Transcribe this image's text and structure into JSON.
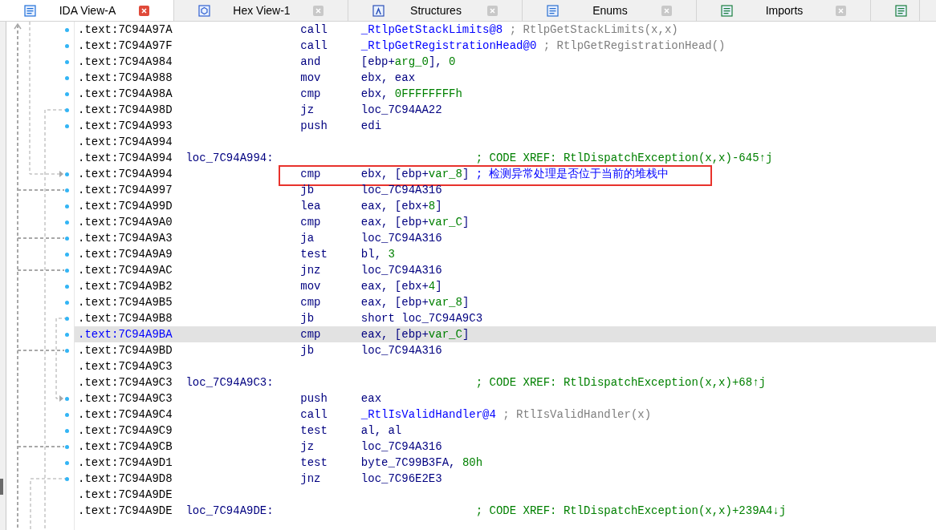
{
  "tabs": [
    {
      "label": "IDA View-A",
      "selected": true
    },
    {
      "label": "Hex View-1",
      "selected": false
    },
    {
      "label": "Structures",
      "selected": false
    },
    {
      "label": "Enums",
      "selected": false
    },
    {
      "label": "Imports",
      "selected": false
    },
    {
      "selected": false
    }
  ],
  "rows": [
    {
      "kind": "instruction",
      "address": ".text:7C94A97A",
      "mnemonic": "call",
      "operand": [
        {
          "t": "_RtlpGetStackLimits@8",
          "kind": "sym"
        }
      ],
      "comment": {
        "t": "; RtlpGetStackLimits(x,x)",
        "kind": "auto"
      },
      "selected": false
    },
    {
      "kind": "instruction",
      "address": ".text:7C94A97F",
      "mnemonic": "call",
      "operand": [
        {
          "t": "_RtlpGetRegistrationHead@0",
          "kind": "sym"
        }
      ],
      "comment": {
        "t": "; RtlpGetRegistrationHead()",
        "kind": "auto"
      },
      "selected": false
    },
    {
      "kind": "instruction",
      "address": ".text:7C94A984",
      "mnemonic": "and",
      "operand": [
        {
          "t": "[ebp+",
          "kind": "plain"
        },
        {
          "t": "arg_0",
          "kind": "num"
        },
        {
          "t": "], ",
          "kind": "plain"
        },
        {
          "t": "0",
          "kind": "num"
        }
      ],
      "selected": false
    },
    {
      "kind": "instruction",
      "address": ".text:7C94A988",
      "mnemonic": "mov",
      "operand": [
        {
          "t": "ebx, eax",
          "kind": "plain"
        }
      ],
      "selected": false
    },
    {
      "kind": "instruction",
      "address": ".text:7C94A98A",
      "mnemonic": "cmp",
      "operand": [
        {
          "t": "ebx, ",
          "kind": "plain"
        },
        {
          "t": "0FFFFFFFFh",
          "kind": "num"
        }
      ],
      "selected": false
    },
    {
      "kind": "instruction",
      "address": ".text:7C94A98D",
      "mnemonic": "jz",
      "operand": [
        {
          "t": "loc_7C94AA22",
          "kind": "plain"
        }
      ],
      "selected": false
    },
    {
      "kind": "instruction",
      "address": ".text:7C94A993",
      "mnemonic": "push",
      "operand": [
        {
          "t": "edi",
          "kind": "plain"
        }
      ],
      "selected": false
    },
    {
      "kind": "blank",
      "address": ".text:7C94A994",
      "selected": false
    },
    {
      "kind": "label",
      "address": ".text:7C94A994",
      "label": "loc_7C94A994:",
      "comment": {
        "t": "; CODE XREF: RtlDispatchException(x,x)-645↑j",
        "kind": "xref"
      },
      "selected": false
    },
    {
      "kind": "instruction",
      "address": ".text:7C94A994",
      "mnemonic": "cmp",
      "operand": [
        {
          "t": "ebx, [ebp+",
          "kind": "plain"
        },
        {
          "t": "var_8",
          "kind": "num"
        },
        {
          "t": "]",
          "kind": "plain"
        }
      ],
      "comment": {
        "t": "; 检测异常处理是否位于当前的堆栈中",
        "kind": "user"
      },
      "annotated": true,
      "selected": false
    },
    {
      "kind": "instruction",
      "address": ".text:7C94A997",
      "mnemonic": "jb",
      "operand": [
        {
          "t": "loc_7C94A316",
          "kind": "plain"
        }
      ],
      "selected": false
    },
    {
      "kind": "instruction",
      "address": ".text:7C94A99D",
      "mnemonic": "lea",
      "operand": [
        {
          "t": "eax, [ebx+",
          "kind": "plain"
        },
        {
          "t": "8",
          "kind": "num"
        },
        {
          "t": "]",
          "kind": "plain"
        }
      ],
      "selected": false
    },
    {
      "kind": "instruction",
      "address": ".text:7C94A9A0",
      "mnemonic": "cmp",
      "operand": [
        {
          "t": "eax, [ebp+",
          "kind": "plain"
        },
        {
          "t": "var_C",
          "kind": "num"
        },
        {
          "t": "]",
          "kind": "plain"
        }
      ],
      "selected": false
    },
    {
      "kind": "instruction",
      "address": ".text:7C94A9A3",
      "mnemonic": "ja",
      "operand": [
        {
          "t": "loc_7C94A316",
          "kind": "plain"
        }
      ],
      "selected": false
    },
    {
      "kind": "instruction",
      "address": ".text:7C94A9A9",
      "mnemonic": "test",
      "operand": [
        {
          "t": "bl, ",
          "kind": "plain"
        },
        {
          "t": "3",
          "kind": "num"
        }
      ],
      "selected": false
    },
    {
      "kind": "instruction",
      "address": ".text:7C94A9AC",
      "mnemonic": "jnz",
      "operand": [
        {
          "t": "loc_7C94A316",
          "kind": "plain"
        }
      ],
      "selected": false
    },
    {
      "kind": "instruction",
      "address": ".text:7C94A9B2",
      "mnemonic": "mov",
      "operand": [
        {
          "t": "eax, [ebx+",
          "kind": "plain"
        },
        {
          "t": "4",
          "kind": "num"
        },
        {
          "t": "]",
          "kind": "plain"
        }
      ],
      "selected": false
    },
    {
      "kind": "instruction",
      "address": ".text:7C94A9B5",
      "mnemonic": "cmp",
      "operand": [
        {
          "t": "eax, [ebp+",
          "kind": "plain"
        },
        {
          "t": "var_8",
          "kind": "num"
        },
        {
          "t": "]",
          "kind": "plain"
        }
      ],
      "selected": false
    },
    {
      "kind": "instruction",
      "address": ".text:7C94A9B8",
      "mnemonic": "jb",
      "operand": [
        {
          "t": "short loc_7C94A9C3",
          "kind": "plain"
        }
      ],
      "selected": false
    },
    {
      "kind": "instruction",
      "address": ".text:7C94A9BA",
      "mnemonic": "cmp",
      "operand": [
        {
          "t": "eax, [ebp+",
          "kind": "plain"
        },
        {
          "t": "var_C",
          "kind": "num"
        },
        {
          "t": "]",
          "kind": "plain"
        }
      ],
      "selected": true
    },
    {
      "kind": "instruction",
      "address": ".text:7C94A9BD",
      "mnemonic": "jb",
      "operand": [
        {
          "t": "loc_7C94A316",
          "kind": "plain"
        }
      ],
      "selected": false
    },
    {
      "kind": "blank",
      "address": ".text:7C94A9C3",
      "selected": false
    },
    {
      "kind": "label",
      "address": ".text:7C94A9C3",
      "label": "loc_7C94A9C3:",
      "comment": {
        "t": "; CODE XREF: RtlDispatchException(x,x)+68↑j",
        "kind": "xref"
      },
      "selected": false
    },
    {
      "kind": "instruction",
      "address": ".text:7C94A9C3",
      "mnemonic": "push",
      "operand": [
        {
          "t": "eax",
          "kind": "plain"
        }
      ],
      "selected": false
    },
    {
      "kind": "instruction",
      "address": ".text:7C94A9C4",
      "mnemonic": "call",
      "operand": [
        {
          "t": "_RtlIsValidHandler@4",
          "kind": "sym"
        }
      ],
      "comment": {
        "t": "; RtlIsValidHandler(x)",
        "kind": "auto"
      },
      "selected": false
    },
    {
      "kind": "instruction",
      "address": ".text:7C94A9C9",
      "mnemonic": "test",
      "operand": [
        {
          "t": "al, al",
          "kind": "plain"
        }
      ],
      "selected": false
    },
    {
      "kind": "instruction",
      "address": ".text:7C94A9CB",
      "mnemonic": "jz",
      "operand": [
        {
          "t": "loc_7C94A316",
          "kind": "plain"
        }
      ],
      "selected": false
    },
    {
      "kind": "instruction",
      "address": ".text:7C94A9D1",
      "mnemonic": "test",
      "operand": [
        {
          "t": "byte_7C99B3FA, ",
          "kind": "plain"
        },
        {
          "t": "80h",
          "kind": "num"
        }
      ],
      "selected": false
    },
    {
      "kind": "instruction",
      "address": ".text:7C94A9D8",
      "mnemonic": "jnz",
      "operand": [
        {
          "t": "loc_7C96E2E3",
          "kind": "plain"
        }
      ],
      "selected": false
    },
    {
      "kind": "blank",
      "address": ".text:7C94A9DE",
      "selected": false
    },
    {
      "kind": "label",
      "address": ".text:7C94A9DE",
      "label": "loc_7C94A9DE:",
      "comment": {
        "t": "; CODE XREF: RtlDispatchException(x,x)+239A4↓j",
        "kind": "xref"
      },
      "selected": false
    }
  ]
}
